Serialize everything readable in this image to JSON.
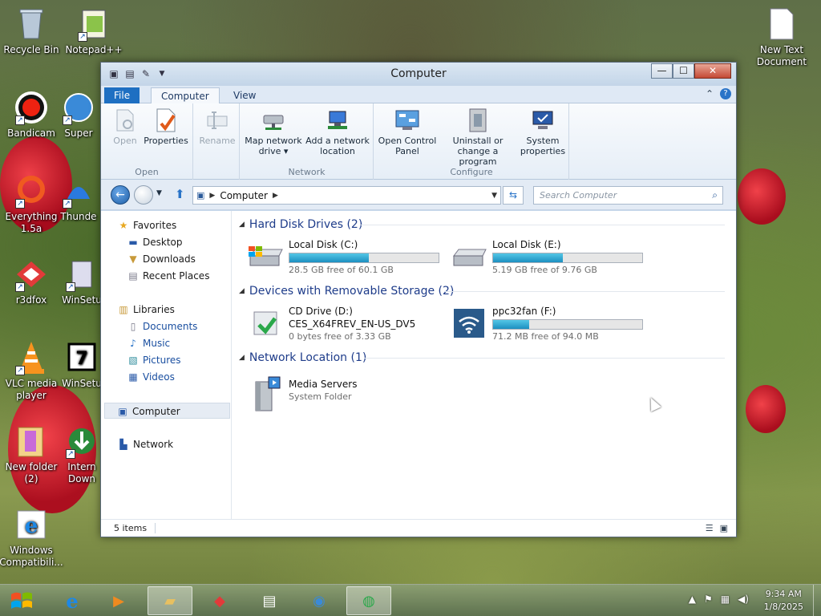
{
  "desktop": {
    "icons": [
      {
        "id": "recycle-bin",
        "label": "Recycle Bin"
      },
      {
        "id": "notepad",
        "label": "Notepad++"
      },
      {
        "id": "bandicam",
        "label": "Bandicam"
      },
      {
        "id": "super",
        "label": "Super"
      },
      {
        "id": "everything",
        "label": "Everything 1.5a"
      },
      {
        "id": "thunder",
        "label": "Thunde"
      },
      {
        "id": "r3dfox",
        "label": "r3dfox"
      },
      {
        "id": "winsetup1",
        "label": "WinSetu"
      },
      {
        "id": "vlc",
        "label": "VLC media player"
      },
      {
        "id": "winsetup2",
        "label": "WinSetu"
      },
      {
        "id": "new-folder",
        "label": "New folder (2)"
      },
      {
        "id": "internet-download",
        "label": "Intern Down"
      },
      {
        "id": "windows-compat",
        "label": "Windows Compatibili..."
      },
      {
        "id": "new-text",
        "label": "New Text Document"
      }
    ]
  },
  "window": {
    "title": "Computer",
    "buttons": {
      "minimize": "—",
      "maximize": "☐",
      "close": "✕"
    },
    "tabs": {
      "file": "File",
      "computer": "Computer",
      "view": "View"
    },
    "ribbon": {
      "open": "Open",
      "properties": "Properties",
      "rename": "Rename",
      "map_drive_1": "Map network",
      "map_drive_2": "drive ▾",
      "add_network_1": "Add a network",
      "add_network_2": "location",
      "control_panel_1": "Open Control",
      "control_panel_2": "Panel",
      "uninstall_1": "Uninstall or",
      "uninstall_2": "change a program",
      "system_1": "System",
      "system_2": "properties",
      "group_open": "Open",
      "group_network": "Network",
      "group_configure": "Configure"
    },
    "address": {
      "path": "Computer",
      "search_placeholder": "Search Computer"
    },
    "nav": {
      "favorites": "Favorites",
      "desktop": "Desktop",
      "downloads": "Downloads",
      "recent": "Recent Places",
      "libraries": "Libraries",
      "documents": "Documents",
      "music": "Music",
      "pictures": "Pictures",
      "videos": "Videos",
      "computer": "Computer",
      "network": "Network"
    },
    "groups": {
      "hdd": "Hard Disk Drives (2)",
      "removable": "Devices with Removable Storage (2)",
      "network": "Network Location (1)"
    },
    "drives": [
      {
        "name": "Local Disk (C:)",
        "free": "28.5 GB free of 60.1 GB",
        "used_fraction": 0.53
      },
      {
        "name": "Local Disk (E:)",
        "free": "5.19 GB free of 9.76 GB",
        "used_fraction": 0.47
      },
      {
        "name": "CD Drive (D:)",
        "label": "CES_X64FREV_EN-US_DV5",
        "free": "0 bytes free of 3.33 GB"
      },
      {
        "name": "ppc32fan (F:)",
        "free": "71.2 MB free of 94.0 MB",
        "used_fraction": 0.24
      },
      {
        "name": "Media Servers",
        "type": "System Folder"
      }
    ],
    "status": {
      "items": "5 items"
    }
  },
  "taskbar": {
    "time": "9:34 AM",
    "date": "1/8/2025"
  }
}
